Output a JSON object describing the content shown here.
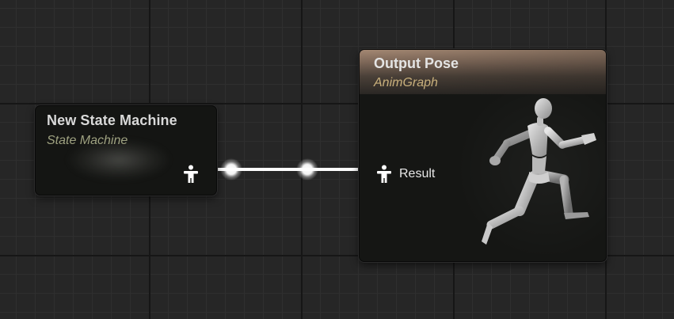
{
  "state_machine_node": {
    "title": "New State Machine",
    "subtitle": "State Machine",
    "output_pin_icon": "pose-person-icon"
  },
  "output_pose_node": {
    "title": "Output Pose",
    "subtitle": "AnimGraph",
    "input_pin_label": "Result",
    "input_pin_icon": "pose-person-icon",
    "preview_icon": "running-mannequin-icon"
  },
  "connection": {
    "from": "New State Machine",
    "to": "Result",
    "reroute_knots": 2
  },
  "colors": {
    "canvas_background": "#262626",
    "grid_major": "#161616",
    "grid_minor": "#2f2f2f",
    "node_body": "#151614",
    "output_header": "#a48873",
    "state_machine_subtitle": "#9ea180",
    "anim_graph_subtitle": "#c9b07c",
    "wire": "#ffffff"
  }
}
